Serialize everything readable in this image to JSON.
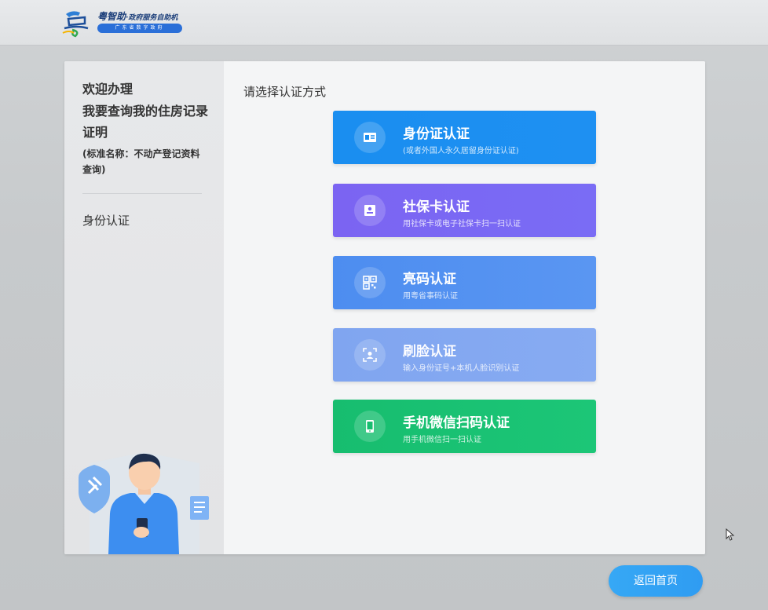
{
  "header": {
    "brand_name": "粤智助",
    "brand_sub": "·政府服务自助机",
    "brand_tag": "广东省数字政府",
    "logo_icon": "yue-logo-icon"
  },
  "sidebar": {
    "welcome": "欢迎办理",
    "service_title": "我要查询我的住房记录证明",
    "standard_name": "(标准名称：不动产登记资料查询)",
    "current_step": "身份认证",
    "illustration_icon": "person-with-phone-icon"
  },
  "main": {
    "prompt": "请选择认证方式",
    "options": [
      {
        "label": "身份证认证",
        "desc": "(或者外国人永久居留身份证认证)",
        "icon": "id-card-icon",
        "color": "#1a8ef0"
      },
      {
        "label": "社保卡认证",
        "desc": "用社保卡或电子社保卡扫一扫认证",
        "icon": "social-card-icon",
        "color": "#7b64f2"
      },
      {
        "label": "亮码认证",
        "desc": "用粤省事码认证",
        "icon": "qr-code-icon",
        "color": "#4d8df0"
      },
      {
        "label": "刷脸认证",
        "desc": "输入身份证号+本机人脸识别认证",
        "icon": "face-scan-icon",
        "color": "#80a5f0"
      },
      {
        "label": "手机微信扫码认证",
        "desc": "用手机微信扫一扫认证",
        "icon": "phone-icon",
        "color": "#17bd6f"
      }
    ]
  },
  "footer": {
    "home_button": "返回首页"
  }
}
